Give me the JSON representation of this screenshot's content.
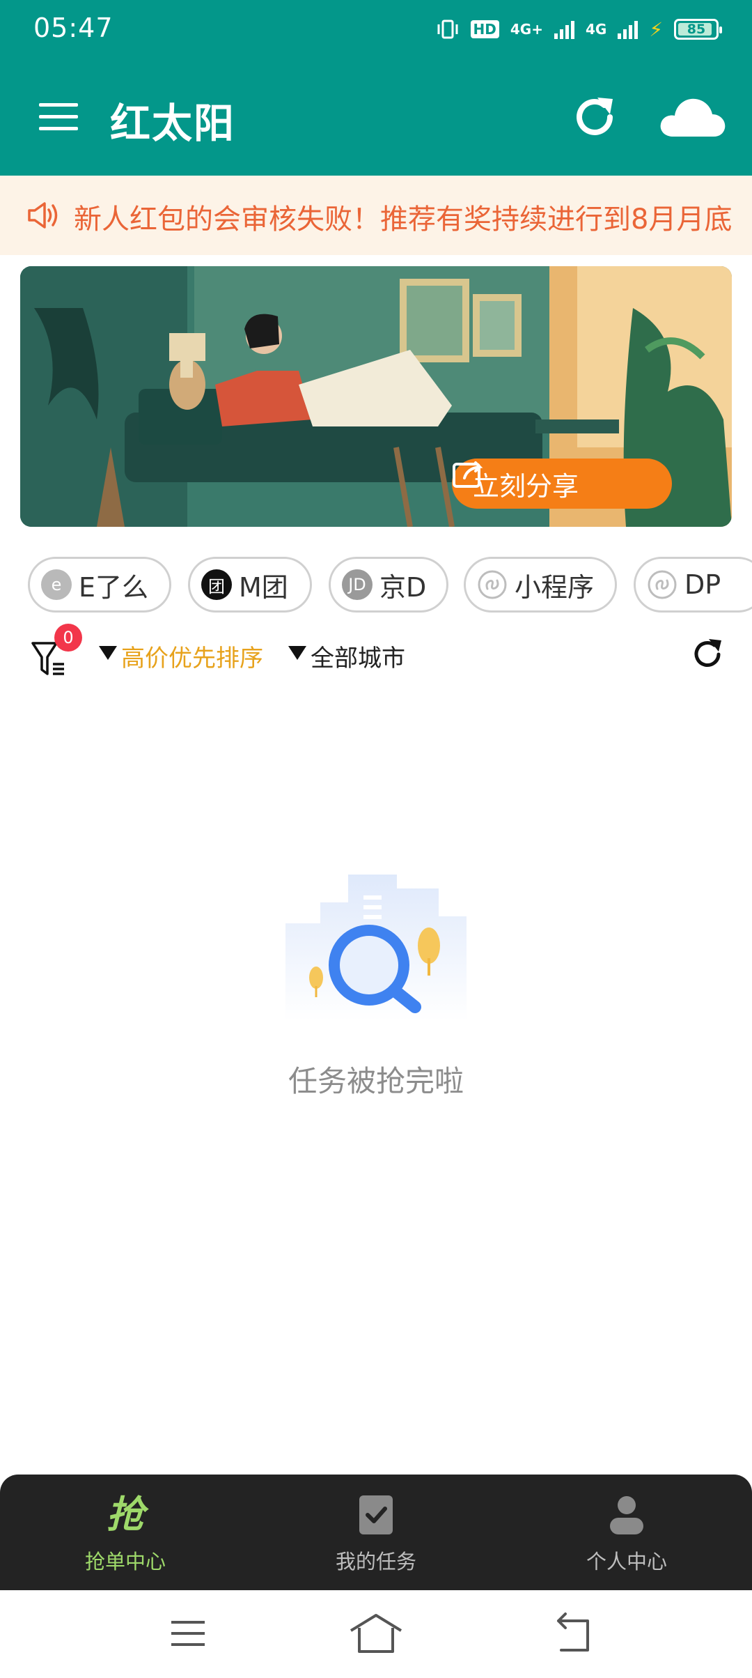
{
  "status_bar": {
    "time": "05:47",
    "hd_label": "HD",
    "net1": "4G+",
    "net2": "4G",
    "battery_level": "85"
  },
  "app_bar": {
    "title": "红太阳",
    "icons": [
      "menu-icon",
      "refresh-icon",
      "cloud-icon"
    ]
  },
  "notice": {
    "icon": "speaker-icon",
    "text": "新人红包的会审核失败！推荐有奖持续进行到8月月底"
  },
  "banner": {
    "share_label": "立刻分享",
    "share_icon": "share-icon"
  },
  "platform_chips": [
    {
      "label": "E了么",
      "icon_text": "e",
      "icon_color": "#b9b9b9"
    },
    {
      "label": "M团",
      "icon_text": "团",
      "icon_color": "#111111"
    },
    {
      "label": "京D",
      "icon_text": "JD",
      "icon_color": "#9a9a9a"
    },
    {
      "label": "小程序",
      "icon_text": "",
      "icon_color": "#bdbdbd"
    },
    {
      "label": "DP",
      "icon_text": "",
      "icon_color": "#bdbdbd"
    }
  ],
  "filter_bar": {
    "filter_count": "0",
    "sort_label": "高价优先排序",
    "city_label": "全部城市"
  },
  "empty_state": {
    "message": "任务被抢完啦"
  },
  "bottom_tabs": [
    {
      "label": "抢单中心",
      "icon_text": "抢",
      "active": true
    },
    {
      "label": "我的任务",
      "icon": "task-check-icon",
      "active": false
    },
    {
      "label": "个人中心",
      "icon": "person-icon",
      "active": false
    }
  ],
  "colors": {
    "primary": "#03978a",
    "accent_orange": "#f57e16",
    "sort_highlight": "#e7a21c",
    "notice_text": "#ea6537",
    "tab_active": "#9ed96a",
    "tabbar_bg": "#232323"
  }
}
